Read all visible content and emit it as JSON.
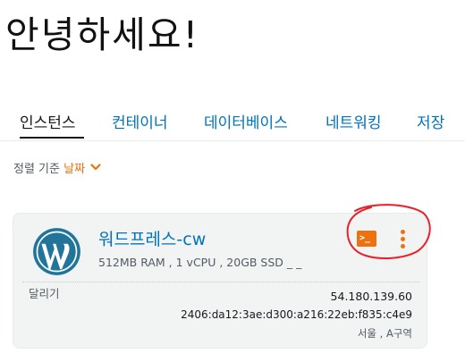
{
  "greeting": "안녕하세요!",
  "tabs": [
    {
      "label": "인스턴스",
      "active": true
    },
    {
      "label": "컨테이너",
      "active": false
    },
    {
      "label": "데이터베이스",
      "active": false
    },
    {
      "label": "네트워킹",
      "active": false
    },
    {
      "label": "저장",
      "active": false
    }
  ],
  "sort": {
    "label": "정렬 기준",
    "value": "날짜",
    "icon": "chevron-down-icon"
  },
  "instance": {
    "logo_icon": "wordpress-logo-icon",
    "name": "워드프레스-cw",
    "specs": "512MB RAM , 1 vCPU , 20GB SSD _ _",
    "status": "달리기",
    "ipv4": "54.180.139.60",
    "ipv6": "2406:da12:3ae:d300:a216:22eb:f835:c4e9",
    "location": "서울 , A구역",
    "actions": {
      "terminal_icon": "terminal-icon",
      "terminal_prompt": ">_",
      "menu_icon": "vertical-ellipsis-icon"
    }
  },
  "colors": {
    "accent_orange": "#ec7211",
    "link_blue": "#0073bb",
    "annotation_red": "#e8202a",
    "card_bg": "#f2f3f3",
    "wordpress_blue": "#21759b"
  }
}
